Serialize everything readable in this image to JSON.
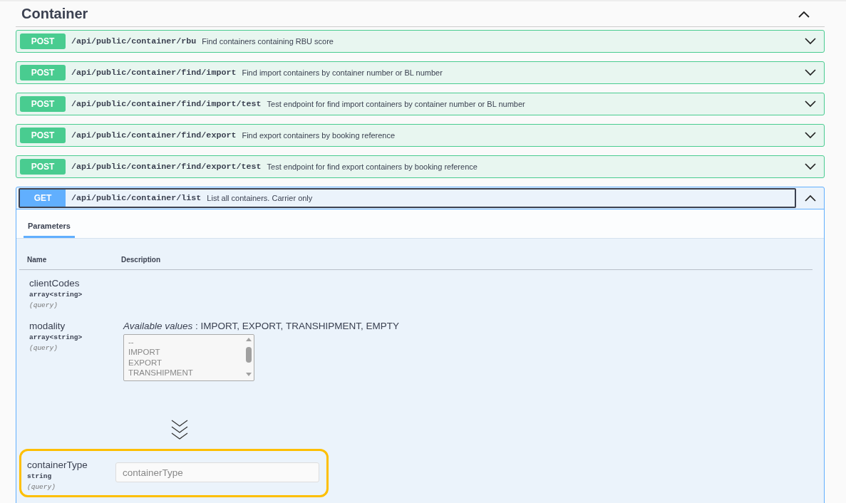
{
  "section": {
    "title": "Container",
    "expanded": true
  },
  "operations": [
    {
      "method": "POST",
      "path": "/api/public/container/rbu",
      "summary": "Find containers containing RBU score",
      "expanded": false
    },
    {
      "method": "POST",
      "path": "/api/public/container/find/import",
      "summary": "Find import containers by container number or BL number",
      "expanded": false
    },
    {
      "method": "POST",
      "path": "/api/public/container/find/import/test",
      "summary": "Test endpoint for find import containers by container number or BL number",
      "expanded": false
    },
    {
      "method": "POST",
      "path": "/api/public/container/find/export",
      "summary": "Find export containers by booking reference",
      "expanded": false
    },
    {
      "method": "POST",
      "path": "/api/public/container/find/export/test",
      "summary": "Test endpoint for find export containers by booking reference",
      "expanded": false
    },
    {
      "method": "GET",
      "path": "/api/public/container/list",
      "summary": "List all containers. Carrier only",
      "expanded": true,
      "tabs": [
        {
          "label": "Parameters",
          "selected": true
        }
      ],
      "columns": [
        "Name",
        "Description"
      ],
      "parameters": [
        {
          "kind": "plain",
          "name": "clientCodes",
          "type": "array<string>",
          "in": "(query)",
          "highlighted": false
        },
        {
          "kind": "enum",
          "name": "modality",
          "type": "array<string>",
          "in": "(query)",
          "highlighted": false,
          "available_label": "Available values",
          "available_values": ": IMPORT, EXPORT, TRANSHIPMENT, EMPTY",
          "options": [
            "--",
            "IMPORT",
            "EXPORT",
            "TRANSHIPMENT"
          ]
        },
        {
          "kind": "text",
          "name": "containerType",
          "type": "string",
          "in": "(query)",
          "highlighted": true,
          "placeholder": "containerType"
        }
      ]
    }
  ]
}
